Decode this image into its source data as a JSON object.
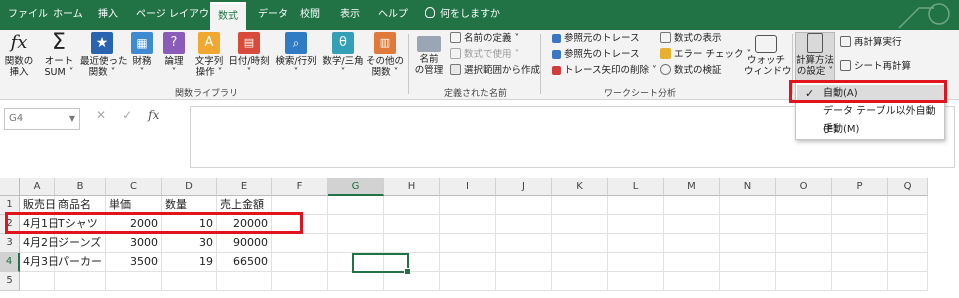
{
  "tabs": [
    "ファイル",
    "ホーム",
    "挿入",
    "ページ レイアウト",
    "数式",
    "データ",
    "校閲",
    "表示",
    "ヘルプ",
    "何をしますか"
  ],
  "active_tab": "数式",
  "ribbon": {
    "function_library": {
      "insert_function": "関数の\n挿入",
      "autosum": "オート\nSUM ˅",
      "recent": "最近使った\n関数 ˅",
      "financial": "財務\n˅",
      "logical": "論理\n˅",
      "text": "文字列\n操作 ˅",
      "datetime": "日付/時刻\n˅",
      "lookup": "検索/行列\n˅",
      "math": "数学/三角\n˅",
      "more": "その他の\n関数 ˅",
      "group_label": "関数ライブラリ"
    },
    "defined_names": {
      "name_manager": "名前\nの管理",
      "define_name": "名前の定義 ˅",
      "use_in_formula": "数式で使用 ˅",
      "create_from_selection": "選択範囲から作成",
      "group_label": "定義された名前"
    },
    "formula_auditing": {
      "trace_precedents": "参照元のトレース",
      "trace_dependents": "参照先のトレース",
      "remove_arrows": "トレース矢印の削除 ˅",
      "show_formulas": "数式の表示",
      "error_checking": "エラー チェック ˅",
      "evaluate_formula": "数式の検証",
      "watch_window": "ウォッチ\nウィンドウ",
      "group_label": "ワークシート分析"
    },
    "calculation": {
      "calc_options": "計算方法\nの設定 ˅",
      "calc_now": "再計算実行",
      "calc_sheet": "シート再計算"
    }
  },
  "calc_menu": {
    "items": [
      "自動(A)",
      "データ テーブル以外自動(E)",
      "手動(M)"
    ],
    "checked_index": 0
  },
  "formula_bar": {
    "name_box": "G4",
    "cancel": "✕",
    "enter": "✓",
    "fx": "fx",
    "content": ""
  },
  "columns": [
    "A",
    "B",
    "C",
    "D",
    "E",
    "F",
    "G",
    "H",
    "I",
    "J",
    "K",
    "L",
    "M",
    "N",
    "O",
    "P",
    "Q"
  ],
  "rows": [
    "1",
    "2",
    "3",
    "4",
    "5"
  ],
  "table": {
    "headers": [
      "販売日",
      "商品名",
      "単価",
      "数量",
      "売上金額"
    ],
    "rows": [
      [
        "4月1日",
        "Tシャツ",
        "2000",
        "10",
        "20000"
      ],
      [
        "4月2日",
        "ジーンズ",
        "3000",
        "30",
        "90000"
      ],
      [
        "4月3日",
        "パーカー",
        "3500",
        "19",
        "66500"
      ]
    ]
  },
  "colors": {
    "accent": "#217346",
    "annotation": "#e1141e"
  }
}
